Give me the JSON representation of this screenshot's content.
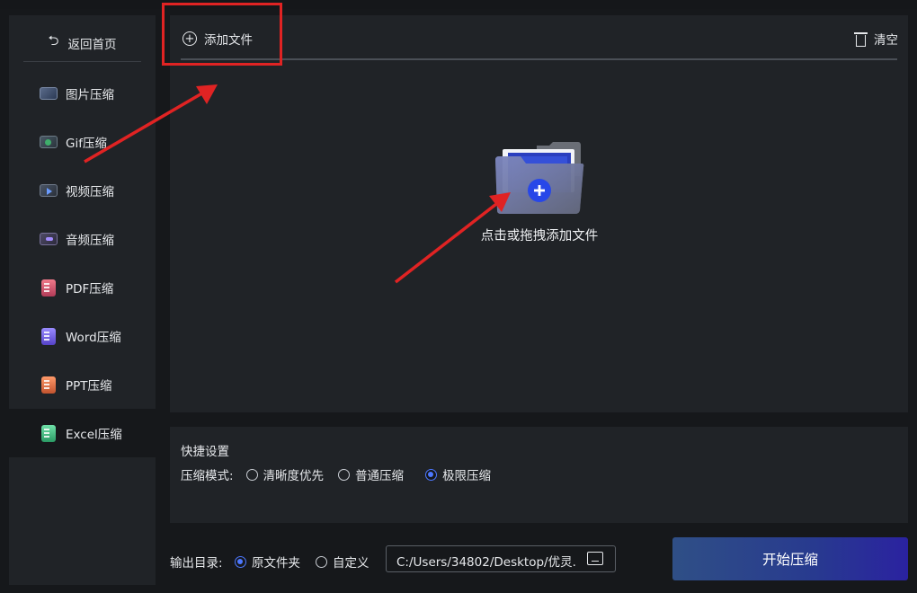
{
  "sidebar": {
    "back_label": "返回首页",
    "items": [
      {
        "label": "图片压缩",
        "icon": "image-icon"
      },
      {
        "label": "Gif压缩",
        "icon": "gif-icon"
      },
      {
        "label": "视频压缩",
        "icon": "video-icon"
      },
      {
        "label": "音频压缩",
        "icon": "audio-icon"
      },
      {
        "label": "PDF压缩",
        "icon": "pdf-icon"
      },
      {
        "label": "Word压缩",
        "icon": "word-icon"
      },
      {
        "label": "PPT压缩",
        "icon": "ppt-icon"
      },
      {
        "label": "Excel压缩",
        "icon": "excel-icon",
        "active": true
      }
    ]
  },
  "toolbar": {
    "add_label": "添加文件",
    "clear_label": "清空"
  },
  "dropzone": {
    "hint": "点击或拖拽添加文件"
  },
  "settings": {
    "title": "快捷设置",
    "mode_label": "压缩模式:",
    "modes": [
      {
        "label": "清晰度优先",
        "selected": false
      },
      {
        "label": "普通压缩",
        "selected": false
      },
      {
        "label": "极限压缩",
        "selected": true
      }
    ]
  },
  "output": {
    "label": "输出目录:",
    "options": [
      {
        "label": "原文件夹",
        "selected": true
      },
      {
        "label": "自定义",
        "selected": false
      }
    ],
    "path": "C:/Users/34802/Desktop/优灵."
  },
  "start_label": "开始压缩",
  "colors": {
    "accent": "#4d78ff",
    "annotation": "#e02323",
    "panel": "#202327",
    "background": "#16181b"
  }
}
